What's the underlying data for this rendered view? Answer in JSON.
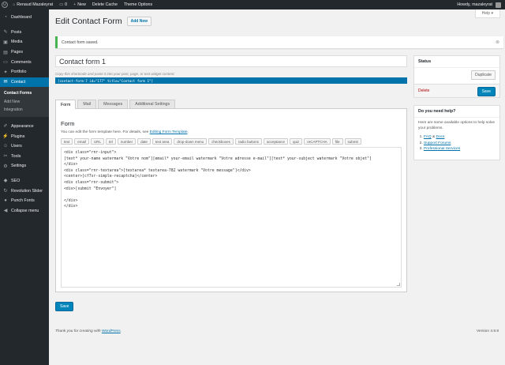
{
  "admin_bar": {
    "site_name": "Renaud Mazaleyrat",
    "comments_count": "0",
    "new_label": "New",
    "delete_cache": "Delete Cache",
    "theme_options": "Theme Options",
    "greeting": "Howdy, mazaleyrat"
  },
  "sidebar": {
    "items": [
      {
        "label": "Dashboard",
        "icon": "dashboard-icon"
      },
      {
        "label": "Posts",
        "icon": "pin-icon"
      },
      {
        "label": "Media",
        "icon": "media-icon"
      },
      {
        "label": "Pages",
        "icon": "page-icon"
      },
      {
        "label": "Comments",
        "icon": "comment-icon"
      },
      {
        "label": "Portfolio",
        "icon": "portfolio-icon"
      },
      {
        "label": "Contact",
        "icon": "mail-icon"
      },
      {
        "label": "Appearance",
        "icon": "brush-icon"
      },
      {
        "label": "Plugins",
        "icon": "plugin-icon"
      },
      {
        "label": "Users",
        "icon": "users-icon"
      },
      {
        "label": "Tools",
        "icon": "wrench-icon"
      },
      {
        "label": "Settings",
        "icon": "settings-icon"
      },
      {
        "label": "SEO",
        "icon": "seo-icon"
      },
      {
        "label": "Revolution Slider",
        "icon": "refresh-icon"
      },
      {
        "label": "Punch Fonts",
        "icon": "font-icon"
      },
      {
        "label": "Collapse menu",
        "icon": "collapse-icon"
      }
    ],
    "contact_sub": [
      "Contact Forms",
      "Add New",
      "Integration"
    ]
  },
  "header": {
    "title": "Edit Contact Form",
    "add_new": "Add New",
    "help": "Help"
  },
  "notice": {
    "message": "Contact form saved."
  },
  "form": {
    "title_value": "Contact form 1",
    "shortcode_hint": "Copy this shortcode and paste it into your post, page, or text widget content:",
    "shortcode": "[contact-form-7 id=\"177\" title=\"Contact form 1\"]",
    "tabs": [
      "Form",
      "Mail",
      "Messages",
      "Additional Settings"
    ],
    "panel_title": "Form",
    "desc_prefix": "You can edit the form template here. For details, see ",
    "desc_link": "Editing Form Template",
    "desc_suffix": ".",
    "tag_buttons": [
      "text",
      "email",
      "URL",
      "tel",
      "number",
      "date",
      "text area",
      "drop-down menu",
      "checkboxes",
      "radio buttons",
      "acceptance",
      "quiz",
      "reCAPTCHA",
      "file",
      "submit"
    ],
    "template": "<div class=\"rnr-input\">\n[text* your-name watermark \"Votre nom\"][email* your-email watermark \"Votre adresse e-mail\"][text* your-subject watermark \"Votre objet\"]\n</div>\n<div class=\"rnr-textarea\">[textarea* textarea-782 watermark \"Votre message\"]</div>\n<center>[cf7sr-simple-recaptcha]</center>\n<div class=\"rnr-submit\">\n<div>[submit \"Envoyer\"]\n\n</div>\n</div>",
    "save": "Save"
  },
  "status_box": {
    "title": "Status",
    "duplicate": "Duplicate",
    "delete": "Delete",
    "save": "Save"
  },
  "help_box": {
    "title": "Do you need help?",
    "text": "Here are some available options to help solve your problems.",
    "links": [
      {
        "a": "FAQ",
        "sep": " & ",
        "b": "Docs"
      },
      {
        "a": "Support Forums"
      },
      {
        "a": "Professional Services"
      }
    ]
  },
  "footer": {
    "thanks_prefix": "Thank you for creating with ",
    "thanks_link": "WordPress",
    "thanks_suffix": ".",
    "version": "Version 4.9.8"
  },
  "colors": {
    "accent": "#0073aa",
    "sidebar": "#23282d",
    "notice_success": "#46b450",
    "delete": "#a00"
  }
}
